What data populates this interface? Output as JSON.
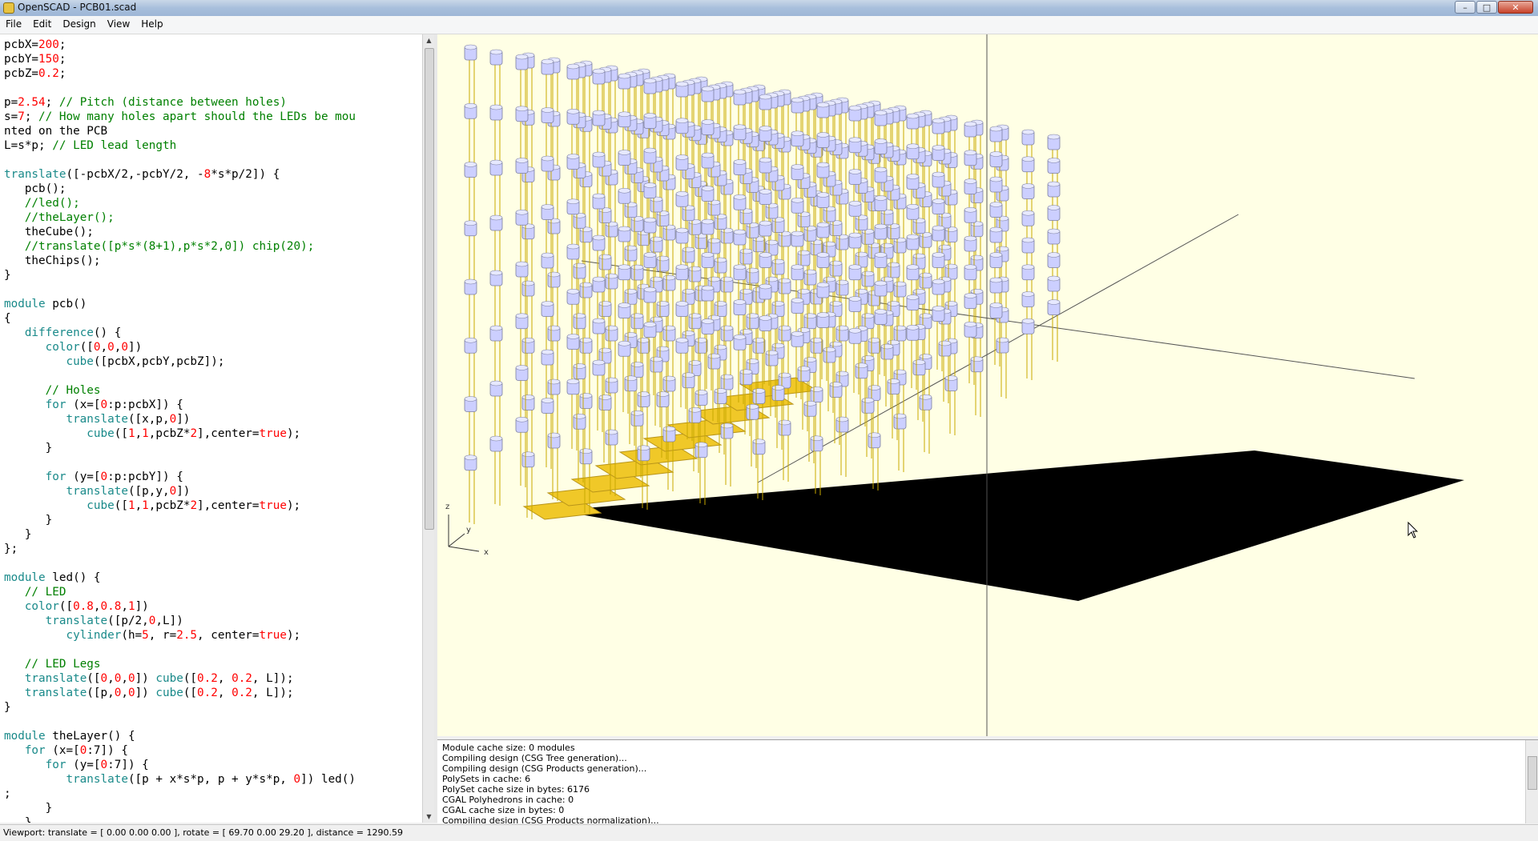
{
  "window": {
    "title": "OpenSCAD - PCB01.scad",
    "minimize": "–",
    "maximize": "□",
    "close": "✕"
  },
  "menu": [
    "File",
    "Edit",
    "Design",
    "View",
    "Help"
  ],
  "colors": {
    "string": "#ff0000",
    "comment": "#008000",
    "keyword": "#1a8a8a",
    "number": "#ff0000"
  },
  "code_lines": [
    "pcbX=200;",
    "pcbY=150;",
    "pcbZ=0.2;",
    "",
    "p=2.54; // Pitch (distance between holes)",
    "s=7; // How many holes apart should the LEDs be mou",
    "nted on the PCB",
    "L=s*p; // LED lead length",
    "",
    "translate([-pcbX/2,-pcbY/2, -8*s*p/2]) {",
    "   pcb();",
    "   //led();",
    "   //theLayer();",
    "   theCube();",
    "   //translate([p*s*(8+1),p*s*2,0]) chip(20);",
    "   theChips();",
    "}",
    "",
    "module pcb()",
    "{",
    "   difference() {",
    "      color([0,0,0])",
    "         cube([pcbX,pcbY,pcbZ]);",
    "",
    "      // Holes",
    "      for (x=[0:p:pcbX]) {",
    "         translate([x,p,0])",
    "            cube([1,1,pcbZ*2],center=true);",
    "      }",
    "",
    "      for (y=[0:p:pcbY]) {",
    "         translate([p,y,0])",
    "            cube([1,1,pcbZ*2],center=true);",
    "      }",
    "   }",
    "};",
    "",
    "module led() {",
    "   // LED",
    "   color([0.8,0.8,1])",
    "      translate([p/2,0,L])",
    "         cylinder(h=5, r=2.5, center=true);",
    "",
    "   // LED Legs",
    "   translate([0,0,0]) cube([0.2, 0.2, L]);",
    "   translate([p,0,0]) cube([0.2, 0.2, L]);",
    "}",
    "",
    "module theLayer() {",
    "   for (x=[0:7]) {",
    "      for (y=[0:7]) {",
    "         translate([p + x*s*p, p + y*s*p, 0]) led()",
    ";",
    "      }",
    "   }"
  ],
  "console_lines": [
    "Module cache size: 0 modules",
    "Compiling design (CSG Tree generation)...",
    "Compiling design (CSG Products generation)...",
    "PolySets in cache: 6",
    "PolySet cache size in bytes: 6176",
    "CGAL Polyhedrons in cache: 0",
    "CGAL cache size in bytes: 0",
    "Compiling design (CSG Products normalization)..."
  ],
  "statusbar": "Viewport: translate = [ 0.00 0.00 0.00 ], rotate = [ 69.70 0.00 29.20 ], distance = 1290.59",
  "axes": {
    "x": "x",
    "y": "y",
    "z": "z"
  },
  "scene_colors": {
    "background": "#ffffe5",
    "pcb": "#000000",
    "led_body": "#cccfff",
    "led_leg": "#c8a800",
    "chip": "#f0c828"
  }
}
